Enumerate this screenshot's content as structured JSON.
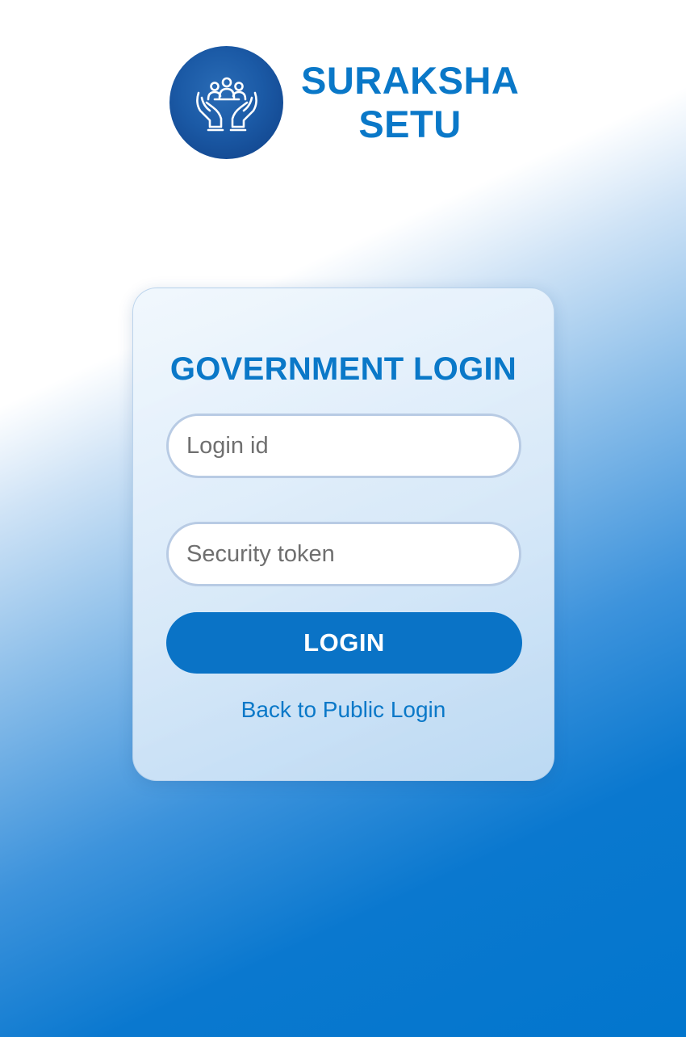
{
  "brand": {
    "line1": "SURAKSHA",
    "line2": "SETU",
    "logo_icon": "hands-protecting-people-icon",
    "color": "#0a78c8"
  },
  "login": {
    "title": "GOVERNMENT LOGIN",
    "login_id_placeholder": "Login id",
    "login_id_value": "",
    "token_placeholder": "Security token",
    "token_value": "",
    "button_label": "LOGIN",
    "back_link": "Back to Public Login"
  },
  "colors": {
    "accent": "#0a73c6",
    "title": "#0a78c8",
    "logo_bg": "#1b5aa6"
  }
}
